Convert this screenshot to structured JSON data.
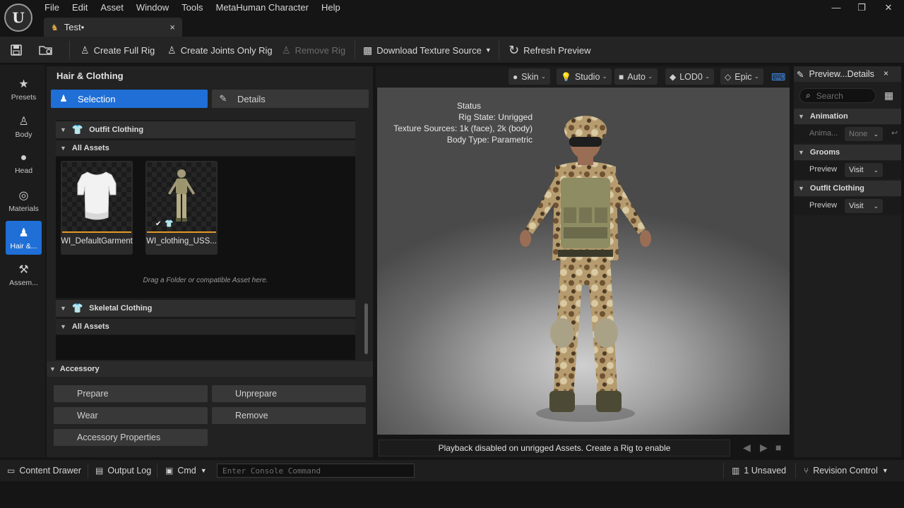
{
  "app": {
    "menu": [
      "File",
      "Edit",
      "Asset",
      "Window",
      "Tools",
      "MetaHuman Character",
      "Help"
    ],
    "doc_tab": {
      "label": "Test•",
      "close": "×"
    },
    "window_controls": {
      "minimize": "—",
      "maximize": "❐",
      "close": "✕"
    }
  },
  "toolbar": {
    "create_full_rig": "Create Full Rig",
    "create_joints_only_rig": "Create Joints Only Rig",
    "remove_rig": "Remove Rig",
    "download_texture_source": "Download Texture Source",
    "refresh_preview": "Refresh Preview"
  },
  "rail": [
    {
      "label": "Presets",
      "icon": "star-icon",
      "glyph": "★"
    },
    {
      "label": "Body",
      "icon": "body-icon",
      "glyph": "♙"
    },
    {
      "label": "Head",
      "icon": "head-icon",
      "glyph": "●"
    },
    {
      "label": "Materials",
      "icon": "materials-icon",
      "glyph": "◎"
    },
    {
      "label": "Hair &...",
      "icon": "hair-clothing-icon",
      "glyph": "♟"
    },
    {
      "label": "Assem...",
      "icon": "assembly-icon",
      "glyph": "⚒"
    }
  ],
  "panel": {
    "title": "Hair & Clothing",
    "tabs": {
      "selection": "Selection",
      "details": "Details"
    },
    "outfit": {
      "header": "Outfit Clothing",
      "sub": "All Assets",
      "assets": [
        "WI_DefaultGarment",
        "WI_clothing_USS..."
      ],
      "drag_hint": "Drag a Folder or compatible Asset here."
    },
    "skeletal": {
      "header": "Skeletal Clothing",
      "sub": "All Assets"
    },
    "accessory": {
      "header": "Accessory",
      "buttons": [
        "Prepare",
        "Unprepare",
        "Wear",
        "Remove",
        "Accessory Properties"
      ]
    }
  },
  "viewport": {
    "buttons": [
      "Skin",
      "Studio",
      "Auto",
      "LOD0",
      "Epic"
    ],
    "status": {
      "title": "Status",
      "lines": [
        "Rig State: Unrigged",
        "Texture Sources: 1k (face), 2k (body)",
        "Body Type: Parametric"
      ]
    },
    "playback": "Playback disabled on unrigged Assets. Create a Rig to enable"
  },
  "details_panel": {
    "title": "Preview...Details",
    "close": "×",
    "search_placeholder": "Search",
    "sections": [
      {
        "name": "Animation",
        "row_label": "Anima...",
        "value": "None"
      },
      {
        "name": "Grooms",
        "row_label": "Preview",
        "value": "Visit"
      },
      {
        "name": "Outfit Clothing",
        "row_label": "Preview",
        "value": "Visit"
      }
    ]
  },
  "bottombar": {
    "content_drawer": "Content Drawer",
    "output_log": "Output Log",
    "cmd": "Cmd",
    "console_placeholder": "Enter Console Command",
    "unsaved": "1 Unsaved",
    "revision_control": "Revision Control"
  }
}
